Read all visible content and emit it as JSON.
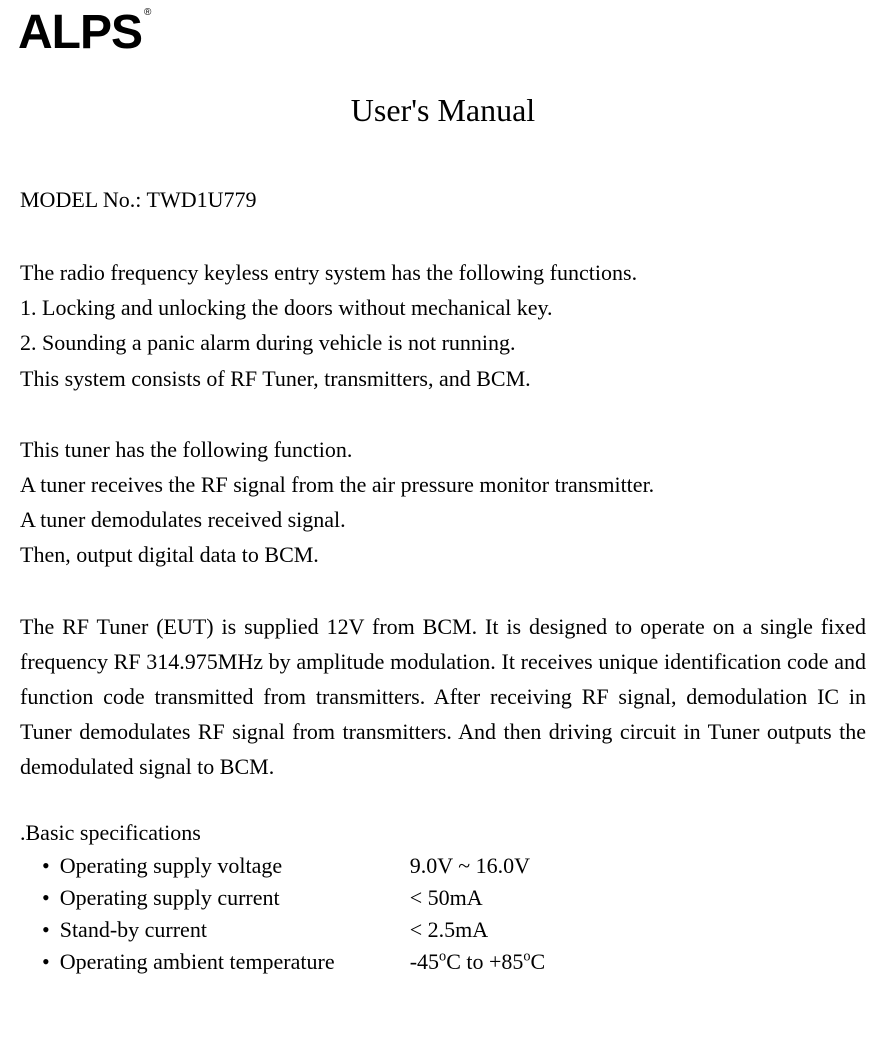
{
  "logo": "ALPS",
  "logo_trademark": "®",
  "title": "User's Manual",
  "model_label": "MODEL No.: TWD1U779",
  "intro": {
    "line1": "The radio frequency keyless entry system has the following functions.",
    "line2": "1. Locking and unlocking the doors without mechanical key.",
    "line3": "2. Sounding a panic alarm during vehicle is not running.",
    "line4": "This system consists of RF Tuner, transmitters, and BCM."
  },
  "tuner": {
    "line1": "This tuner has the following function.",
    "line2": "A tuner receives the RF signal from the air pressure monitor transmitter.",
    "line3": "A tuner demodulates received signal.",
    "line4": "Then, output digital data to BCM."
  },
  "description": "The RF Tuner (EUT) is supplied 12V from BCM. It is designed to operate on a single fixed frequency RF 314.975MHz by amplitude modulation. It receives unique identification code and function code transmitted from transmitters. After receiving RF signal, demodulation IC in Tuner demodulates RF signal from transmitters. And then driving circuit in Tuner outputs the demodulated signal to BCM.",
  "specs_heading": ".Basic specifications",
  "specs": [
    {
      "label": "Operating supply voltage",
      "value": "9.0V ~ 16.0V"
    },
    {
      "label": "Operating supply current",
      "value": "< 50mA"
    },
    {
      "label": "Stand-by current",
      "value": "< 2.5mA"
    },
    {
      "label": "Operating ambient temperature",
      "value_html": "-45<sup>o</sup>C to +85<sup>o</sup>C"
    }
  ]
}
